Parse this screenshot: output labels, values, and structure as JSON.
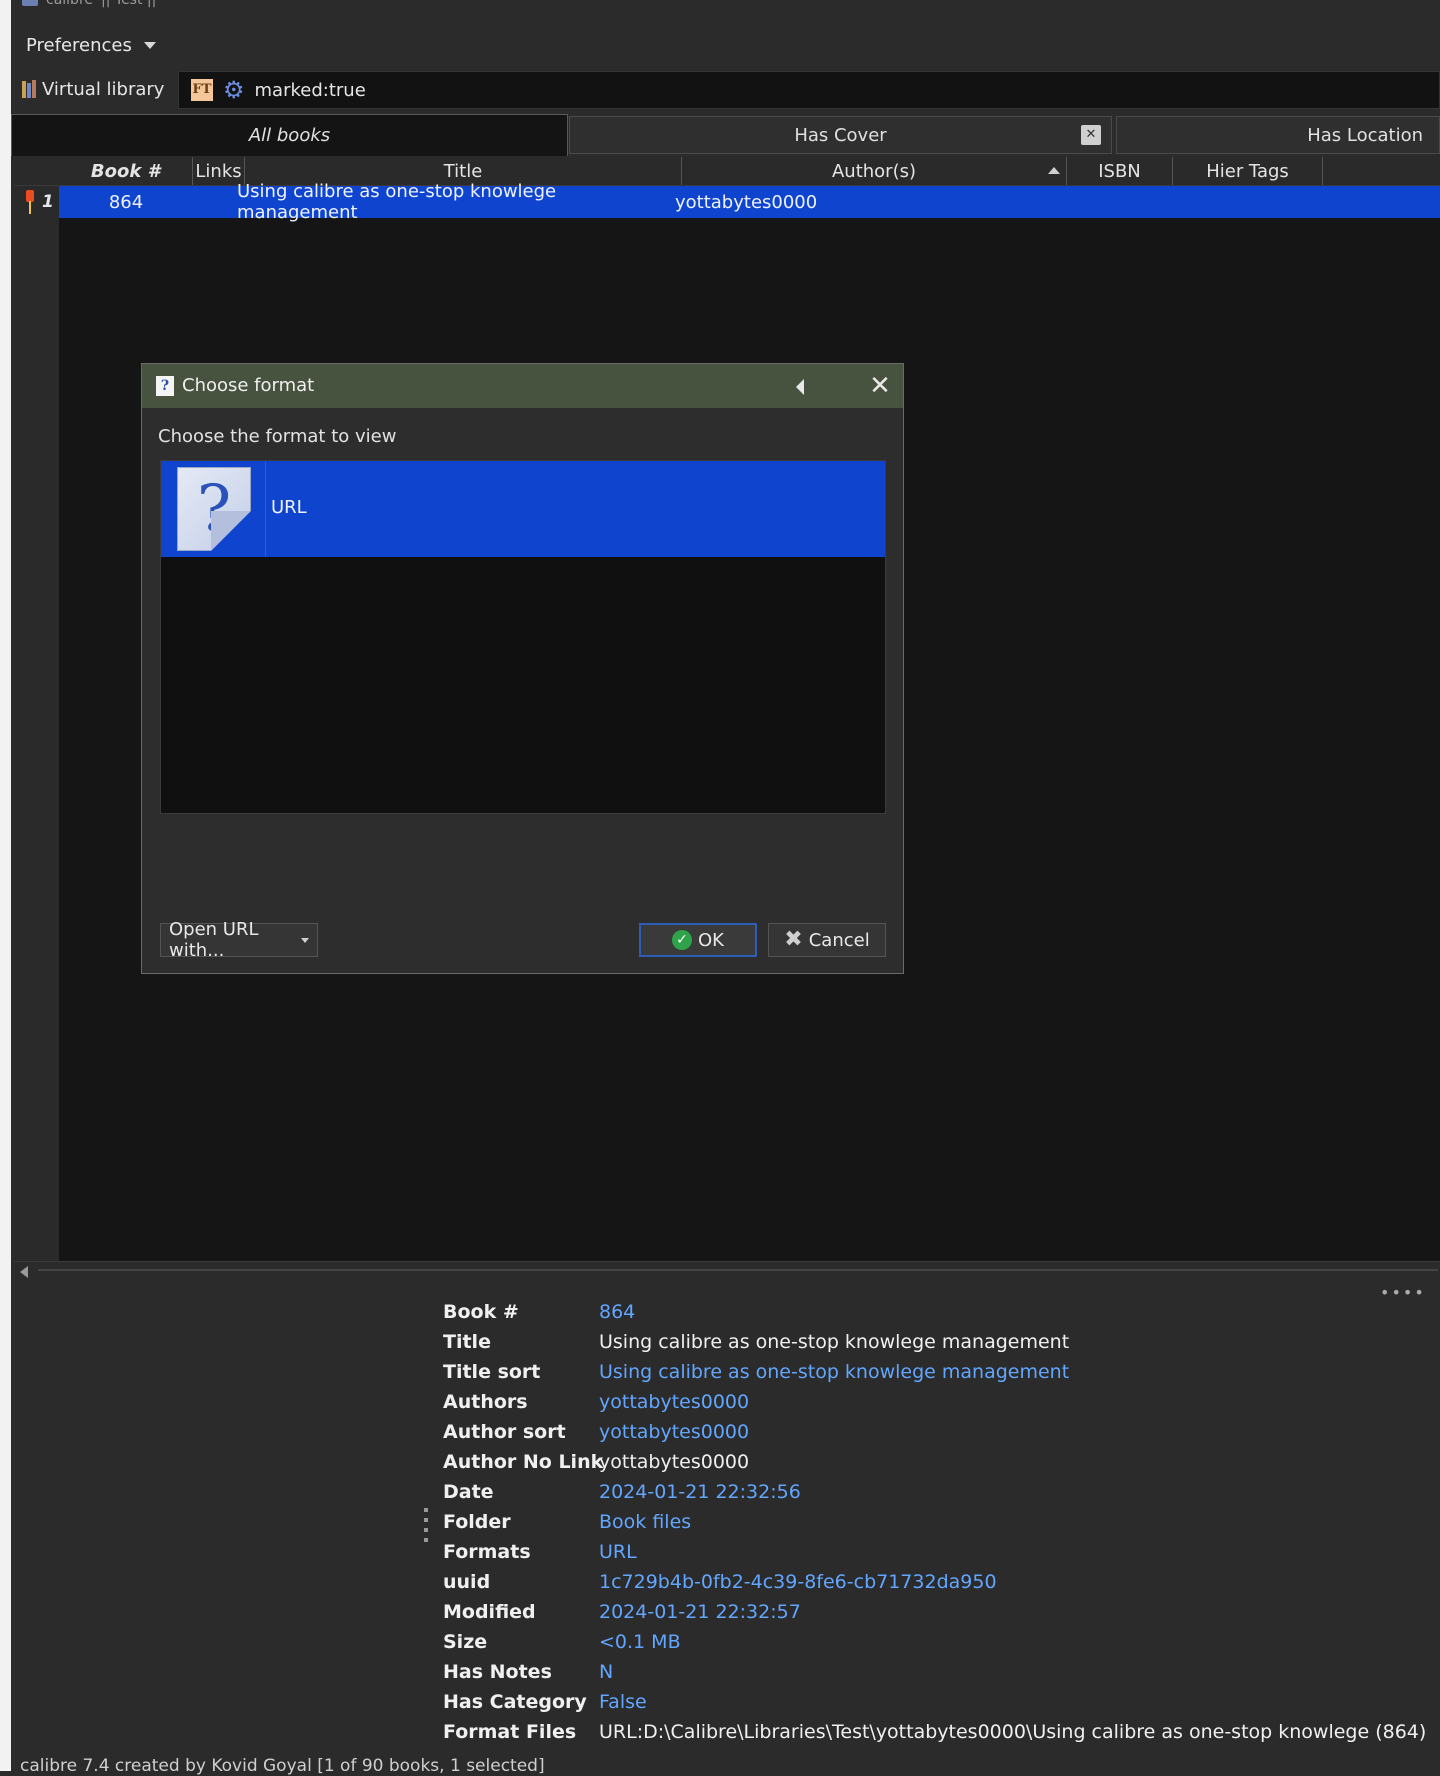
{
  "window": {
    "app_name": "calibre",
    "library_name": "|| Test ||"
  },
  "toolbar": {
    "preferences_label": "Preferences"
  },
  "search": {
    "virtual_library_label": "Virtual library",
    "ft_label": "FT",
    "query": "marked:true"
  },
  "tabs": [
    {
      "label": "All books",
      "active": true
    },
    {
      "label": "Has Cover",
      "active": false
    },
    {
      "label": "Has Location",
      "active": false
    }
  ],
  "book_list": {
    "columns": [
      "Book #",
      "Links",
      "Title",
      "Author(s)",
      "ISBN",
      "Hier Tags"
    ],
    "rows": [
      {
        "row_number": "1",
        "book_number": "864",
        "links": "",
        "title": "Using calibre as one-stop knowlege management",
        "authors": "yottabytes0000",
        "isbn": "",
        "hier_tags": ""
      }
    ]
  },
  "dialog": {
    "title": "Choose format",
    "prompt": "Choose the format to view",
    "formats": [
      {
        "label": "URL",
        "icon": "question-mark-icon"
      }
    ],
    "open_with_label": "Open URL with...",
    "ok_label": "OK",
    "cancel_label": "Cancel"
  },
  "details": [
    {
      "label": "Book #",
      "value": "864",
      "link": true
    },
    {
      "label": "Title",
      "value": "Using calibre as one-stop knowlege management",
      "link": false
    },
    {
      "label": "Title sort",
      "value": "Using calibre as one-stop knowlege management",
      "link": true
    },
    {
      "label": "Authors",
      "value": "yottabytes0000",
      "link": true
    },
    {
      "label": "Author sort",
      "value": "yottabytes0000",
      "link": true
    },
    {
      "label": "Author No Link",
      "value": "yottabytes0000",
      "link": false
    },
    {
      "label": "Date",
      "value": "2024-01-21 22:32:56",
      "link": true
    },
    {
      "label": "Folder",
      "value": "Book files",
      "link": true
    },
    {
      "label": "Formats",
      "value": "URL",
      "link": true
    },
    {
      "label": "uuid",
      "value": "1c729b4b-0fb2-4c39-8fe6-cb71732da950",
      "link": true
    },
    {
      "label": "Modified",
      "value": "2024-01-21 22:32:57",
      "link": true
    },
    {
      "label": "Size",
      "value": "<0.1 MB",
      "link": true
    },
    {
      "label": "Has Notes",
      "value": "N",
      "link": true
    },
    {
      "label": "Has Category",
      "value": "False",
      "link": true
    },
    {
      "label": "Format Files",
      "value": "URL:D:\\Calibre\\Libraries\\Test\\yottabytes0000\\Using calibre as one-stop knowlege (864)",
      "link": false
    }
  ],
  "status_bar": {
    "text": "calibre 7.4 created by Kovid Goyal   [1 of 90 books, 1 selected]"
  },
  "colors": {
    "selection": "#0f44cf",
    "link": "#62a6ff",
    "dialog_title_bg": "#47523f"
  }
}
